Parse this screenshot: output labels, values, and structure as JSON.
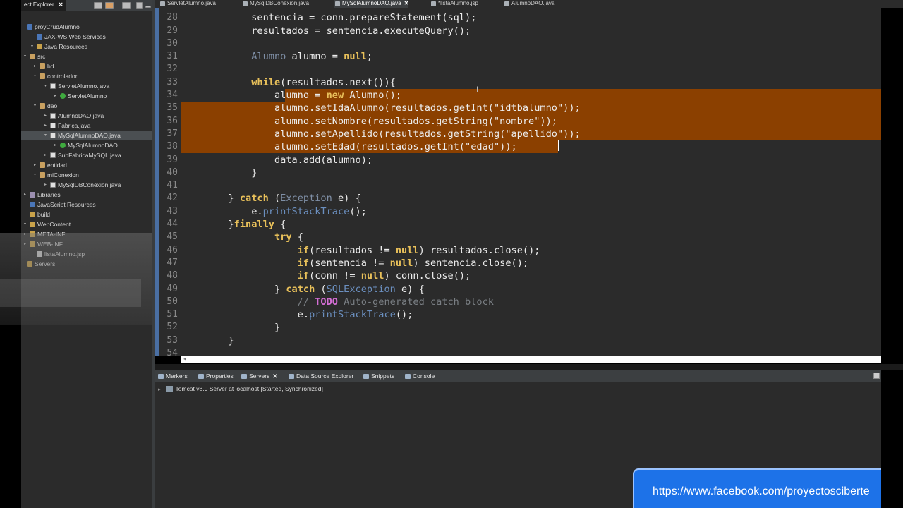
{
  "explorer": {
    "title": "ect Explorer",
    "close": "✕",
    "items": [
      {
        "label": "proyCrudAlumno",
        "icon": "proj"
      },
      {
        "label": "JAX-WS Web Services",
        "icon": "proj"
      },
      {
        "label": "Java Resources",
        "icon": "fold"
      },
      {
        "label": "src",
        "icon": "pkg"
      },
      {
        "label": "bd",
        "icon": "pkg"
      },
      {
        "label": "controlador",
        "icon": "pkg"
      },
      {
        "label": "ServletAlumno.java",
        "icon": "java"
      },
      {
        "label": "ServletAlumno",
        "icon": "cls"
      },
      {
        "label": "dao",
        "icon": "pkg"
      },
      {
        "label": "AlumnoDAO.java",
        "icon": "java"
      },
      {
        "label": "Fabrica.java",
        "icon": "java"
      },
      {
        "label": "MySqlAlumnoDAO.java",
        "icon": "java"
      },
      {
        "label": "MySqlAlumnoDAO",
        "icon": "cls"
      },
      {
        "label": "SubFabricaMySQL.java",
        "icon": "java"
      },
      {
        "label": "entidad",
        "icon": "pkg"
      },
      {
        "label": "miConexion",
        "icon": "pkg"
      },
      {
        "label": "MySqlDBConexion.java",
        "icon": "java"
      },
      {
        "label": "Libraries",
        "icon": "lib"
      },
      {
        "label": "JavaScript Resources",
        "icon": "proj"
      },
      {
        "label": "build",
        "icon": "fold"
      },
      {
        "label": "WebContent",
        "icon": "fold"
      },
      {
        "label": "META-INF",
        "icon": "fold"
      },
      {
        "label": "WEB-INF",
        "icon": "fold"
      },
      {
        "label": "listaAlumno.jsp",
        "icon": "jsp"
      },
      {
        "label": "Servers",
        "icon": "fold"
      }
    ]
  },
  "editor": {
    "tabs": [
      {
        "label": "ServletAlumno.java"
      },
      {
        "label": "MySqlDBConexion.java"
      },
      {
        "label": "MySqlAlumnoDAO.java",
        "close": "✕"
      },
      {
        "label": "*listaAlumno.jsp"
      },
      {
        "label": "AlumnoDAO.java"
      }
    ],
    "line_numbers": [
      "28",
      "29",
      "30",
      "31",
      "32",
      "33",
      "34",
      "35",
      "36",
      "37",
      "38",
      "39",
      "40",
      "41",
      "42",
      "43",
      "44",
      "45",
      "46",
      "47",
      "48",
      "49",
      "50",
      "51",
      "52",
      "53",
      "54"
    ],
    "code": [
      [
        {
          "t": "            sentencia = conn.prepareStatement(sql);",
          "c": ""
        }
      ],
      [
        {
          "t": "            resultados = sentencia.executeQuery();",
          "c": ""
        }
      ],
      [
        {
          "t": "",
          "c": ""
        }
      ],
      [
        {
          "t": "            ",
          "c": ""
        },
        {
          "t": "Alumno",
          "c": "cls"
        },
        {
          "t": " alumno = ",
          "c": ""
        },
        {
          "t": "null",
          "c": "kw"
        },
        {
          "t": ";",
          "c": ""
        }
      ],
      [
        {
          "t": "",
          "c": ""
        }
      ],
      [
        {
          "t": "            ",
          "c": ""
        },
        {
          "t": "while",
          "c": "kw"
        },
        {
          "t": "(resultados.next()){",
          "c": ""
        }
      ],
      [
        {
          "t": "                alumno = ",
          "c": ""
        },
        {
          "t": "new",
          "c": "kw"
        },
        {
          "t": " Alumno();",
          "c": ""
        }
      ],
      [
        {
          "t": "                alumno.setIdaAlumno(resultados.getInt(\"idtbalumno\"));",
          "c": ""
        }
      ],
      [
        {
          "t": "                alumno.setNombre(resultados.getString(\"nombre\"));",
          "c": ""
        }
      ],
      [
        {
          "t": "                alumno.setApellido(resultados.getString(\"apellido\"));",
          "c": ""
        }
      ],
      [
        {
          "t": "                alumno.setEdad(resultados.getInt(\"edad\"));",
          "c": ""
        }
      ],
      [
        {
          "t": "                data.add(alumno);",
          "c": ""
        }
      ],
      [
        {
          "t": "            }",
          "c": ""
        }
      ],
      [
        {
          "t": "",
          "c": ""
        }
      ],
      [
        {
          "t": "        } ",
          "c": ""
        },
        {
          "t": "catch",
          "c": "kw"
        },
        {
          "t": " (",
          "c": ""
        },
        {
          "t": "Exception",
          "c": "cls"
        },
        {
          "t": " e) {",
          "c": ""
        }
      ],
      [
        {
          "t": "            e.",
          "c": ""
        },
        {
          "t": "printStackTrace",
          "c": "mth"
        },
        {
          "t": "();",
          "c": ""
        }
      ],
      [
        {
          "t": "        }",
          "c": ""
        },
        {
          "t": "finally",
          "c": "kw"
        },
        {
          "t": " {",
          "c": ""
        }
      ],
      [
        {
          "t": "                ",
          "c": ""
        },
        {
          "t": "try",
          "c": "kw"
        },
        {
          "t": " {",
          "c": ""
        }
      ],
      [
        {
          "t": "                    ",
          "c": ""
        },
        {
          "t": "if",
          "c": "kw"
        },
        {
          "t": "(resultados != ",
          "c": ""
        },
        {
          "t": "null",
          "c": "kw"
        },
        {
          "t": ") resultados.close();",
          "c": ""
        }
      ],
      [
        {
          "t": "                    ",
          "c": ""
        },
        {
          "t": "if",
          "c": "kw"
        },
        {
          "t": "(sentencia != ",
          "c": ""
        },
        {
          "t": "null",
          "c": "kw"
        },
        {
          "t": ") sentencia.close();",
          "c": ""
        }
      ],
      [
        {
          "t": "                    ",
          "c": ""
        },
        {
          "t": "if",
          "c": "kw"
        },
        {
          "t": "(conn != ",
          "c": ""
        },
        {
          "t": "null",
          "c": "kw"
        },
        {
          "t": ") conn.close();",
          "c": ""
        }
      ],
      [
        {
          "t": "                } ",
          "c": ""
        },
        {
          "t": "catch",
          "c": "kw"
        },
        {
          "t": " (",
          "c": ""
        },
        {
          "t": "SQLException",
          "c": "mth"
        },
        {
          "t": " e) {",
          "c": ""
        }
      ],
      [
        {
          "t": "                    ",
          "c": ""
        },
        {
          "t": "// ",
          "c": "cm"
        },
        {
          "t": "TODO",
          "c": "todo"
        },
        {
          "t": " Auto-generated catch block",
          "c": "cm"
        }
      ],
      [
        {
          "t": "                    e.",
          "c": ""
        },
        {
          "t": "printStackTrace",
          "c": "mth"
        },
        {
          "t": "();",
          "c": ""
        }
      ],
      [
        {
          "t": "                }",
          "c": ""
        }
      ],
      [
        {
          "t": "        }",
          "c": ""
        }
      ],
      [
        {
          "t": "",
          "c": ""
        }
      ]
    ],
    "selection_color": "#8b4000"
  },
  "bottom_panel": {
    "tabs": [
      {
        "label": "Markers"
      },
      {
        "label": "Properties"
      },
      {
        "label": "Servers",
        "close": "✕"
      },
      {
        "label": "Data Source Explorer"
      },
      {
        "label": "Snippets"
      },
      {
        "label": "Console"
      }
    ],
    "server_row": "Tomcat v8.0 Server at localhost  [Started, Synchronized]"
  },
  "banner": {
    "text": "https://www.facebook.com/proyectosciberte",
    "color": "#1d72e8"
  }
}
